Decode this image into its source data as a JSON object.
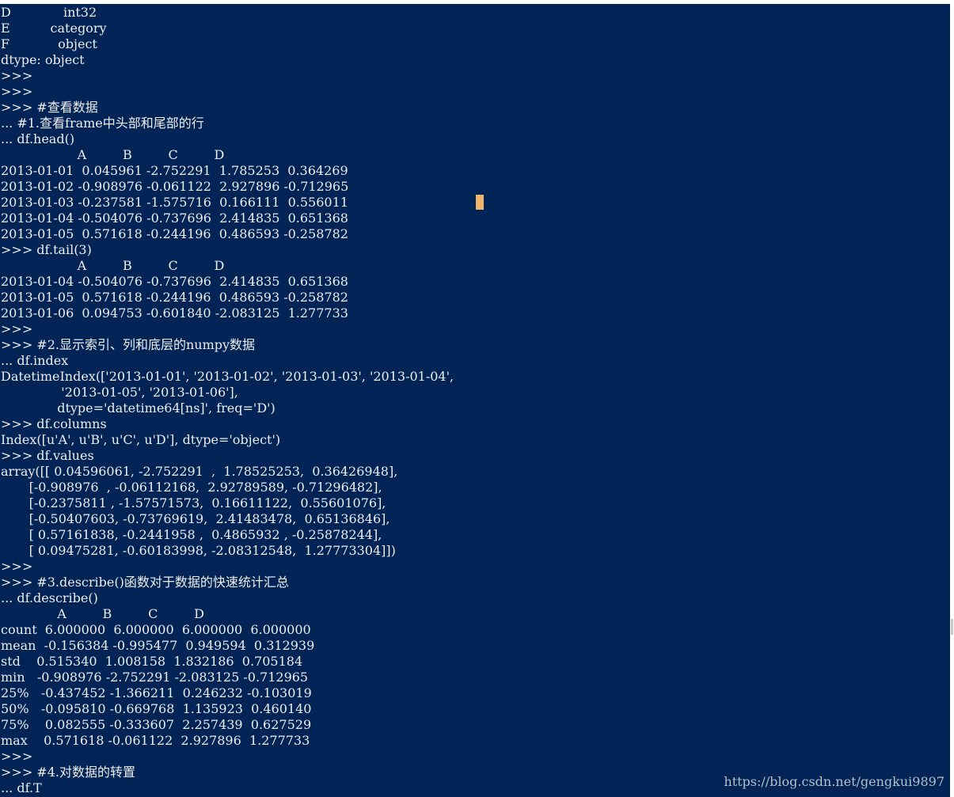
{
  "terminal": {
    "lines": [
      "D             int32",
      "E          category",
      "F            object",
      "dtype: object",
      ">>>",
      ">>>",
      ">>> #查看数据",
      "... #1.查看frame中头部和尾部的行",
      "... df.head()",
      "                   A         B         C         D",
      "2013-01-01  0.045961 -2.752291  1.785253  0.364269",
      "2013-01-02 -0.908976 -0.061122  2.927896 -0.712965",
      "2013-01-03 -0.237581 -1.575716  0.166111  0.556011",
      "2013-01-04 -0.504076 -0.737696  2.414835  0.651368",
      "2013-01-05  0.571618 -0.244196  0.486593 -0.258782",
      ">>> df.tail(3)",
      "                   A         B         C         D",
      "2013-01-04 -0.504076 -0.737696  2.414835  0.651368",
      "2013-01-05  0.571618 -0.244196  0.486593 -0.258782",
      "2013-01-06  0.094753 -0.601840 -2.083125  1.277733",
      ">>>",
      ">>> #2.显示索引、列和底层的numpy数据",
      "... df.index",
      "DatetimeIndex(['2013-01-01', '2013-01-02', '2013-01-03', '2013-01-04',",
      "               '2013-01-05', '2013-01-06'],",
      "              dtype='datetime64[ns]', freq='D')",
      ">>> df.columns",
      "Index([u'A', u'B', u'C', u'D'], dtype='object')",
      ">>> df.values",
      "array([[ 0.04596061, -2.752291  ,  1.78525253,  0.36426948],",
      "       [-0.908976  , -0.06112168,  2.92789589, -0.71296482],",
      "       [-0.2375811 , -1.57571573,  0.16611122,  0.55601076],",
      "       [-0.50407603, -0.73769619,  2.41483478,  0.65136846],",
      "       [ 0.57161838, -0.2441958 ,  0.4865932 , -0.25878244],",
      "       [ 0.09475281, -0.60183998, -2.08312548,  1.27773304]])",
      ">>>",
      ">>> #3.describe()函数对于数据的快速统计汇总",
      "... df.describe()",
      "              A         B         C         D",
      "count  6.000000  6.000000  6.000000  6.000000",
      "mean  -0.156384 -0.995477  0.949594  0.312939",
      "std    0.515340  1.008158  1.832186  0.705184",
      "min   -0.908976 -2.752291 -2.083125 -0.712965",
      "25%   -0.437452 -1.366211  0.246232 -0.103019",
      "50%   -0.095810 -0.669768  1.135923  0.460140",
      "75%    0.082555 -0.333607  2.257439  0.627529",
      "max    0.571618 -0.061122  2.927896  1.277733",
      ">>>",
      ">>> #4.对数据的转置",
      "... df.T"
    ]
  },
  "watermark": "https://blog.csdn.net/gengkui9897",
  "colors": {
    "background": "#012456",
    "text": "#eeedf0",
    "cursor": "#eeb56a"
  }
}
